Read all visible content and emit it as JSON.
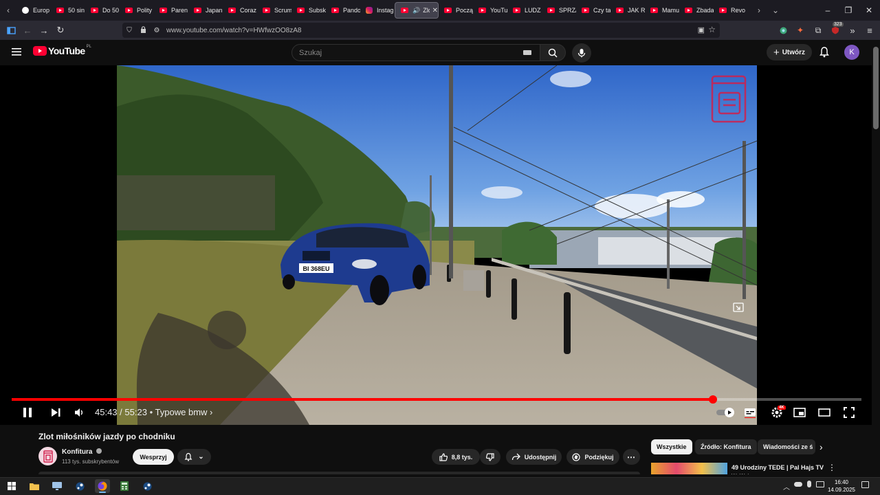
{
  "browser": {
    "tabs": [
      {
        "label": "Europ",
        "icon": "globe-icon"
      },
      {
        "label": "50 sin",
        "icon": "youtube-icon"
      },
      {
        "label": "Do 50",
        "icon": "youtube-icon"
      },
      {
        "label": "Polity",
        "icon": "youtube-icon"
      },
      {
        "label": "Paren",
        "icon": "youtube-icon"
      },
      {
        "label": "Japan",
        "icon": "youtube-icon"
      },
      {
        "label": "Coraz",
        "icon": "youtube-icon"
      },
      {
        "label": "Scrum",
        "icon": "youtube-icon"
      },
      {
        "label": "Subsk",
        "icon": "youtube-icon"
      },
      {
        "label": "Pando",
        "icon": "youtube-icon"
      },
      {
        "label": "Instag",
        "icon": "instagram-icon"
      },
      {
        "label": "Zlot",
        "icon": "youtube-icon",
        "active": true
      },
      {
        "label": "Począ",
        "icon": "youtube-icon"
      },
      {
        "label": "YouTu",
        "icon": "youtube-icon"
      },
      {
        "label": "LUDZ",
        "icon": "youtube-icon"
      },
      {
        "label": "SPRZ/",
        "icon": "youtube-icon"
      },
      {
        "label": "Czy ta",
        "icon": "youtube-icon"
      },
      {
        "label": "JAK R",
        "icon": "youtube-icon"
      },
      {
        "label": "Mamu",
        "icon": "youtube-icon"
      },
      {
        "label": "Zbada",
        "icon": "youtube-icon"
      },
      {
        "label": "Revo",
        "icon": "youtube-icon"
      }
    ],
    "url": "www.youtube.com/watch?v=HWfwzOO8zA8",
    "extension_badge": "323"
  },
  "youtube": {
    "logo_text": "YouTube",
    "logo_region": "PL",
    "search_placeholder": "Szukaj",
    "create_label": "Utwórz",
    "avatar_letter": "K"
  },
  "player": {
    "current_time": "45:43",
    "duration": "55:23",
    "time_separator": "/",
    "chapter": "Typowe bmw",
    "progress_fraction": 0.825,
    "quality_badge": "4K",
    "plate_text": "BI 368EU"
  },
  "video_info": {
    "title": "Zlot miłośników jazdy po chodniku",
    "channel_name": "Konfitura",
    "subscribers": "113 tys. subskrybentów",
    "support_label": "Wesprzyj",
    "likes": "8,8 tys.",
    "share_label": "Udostępnij",
    "thanks_label": "Podziękuj"
  },
  "recommendations": {
    "chips": [
      "Wszystkie",
      "Źródło: Konfitura",
      "Wiadomości ze ś"
    ],
    "first_title": "49 Urodziny TEDE | Pal Hajs TV",
    "first_channel": "WaWaka"
  },
  "taskbar": {
    "time": "16:40",
    "date": "14.09.2025"
  }
}
